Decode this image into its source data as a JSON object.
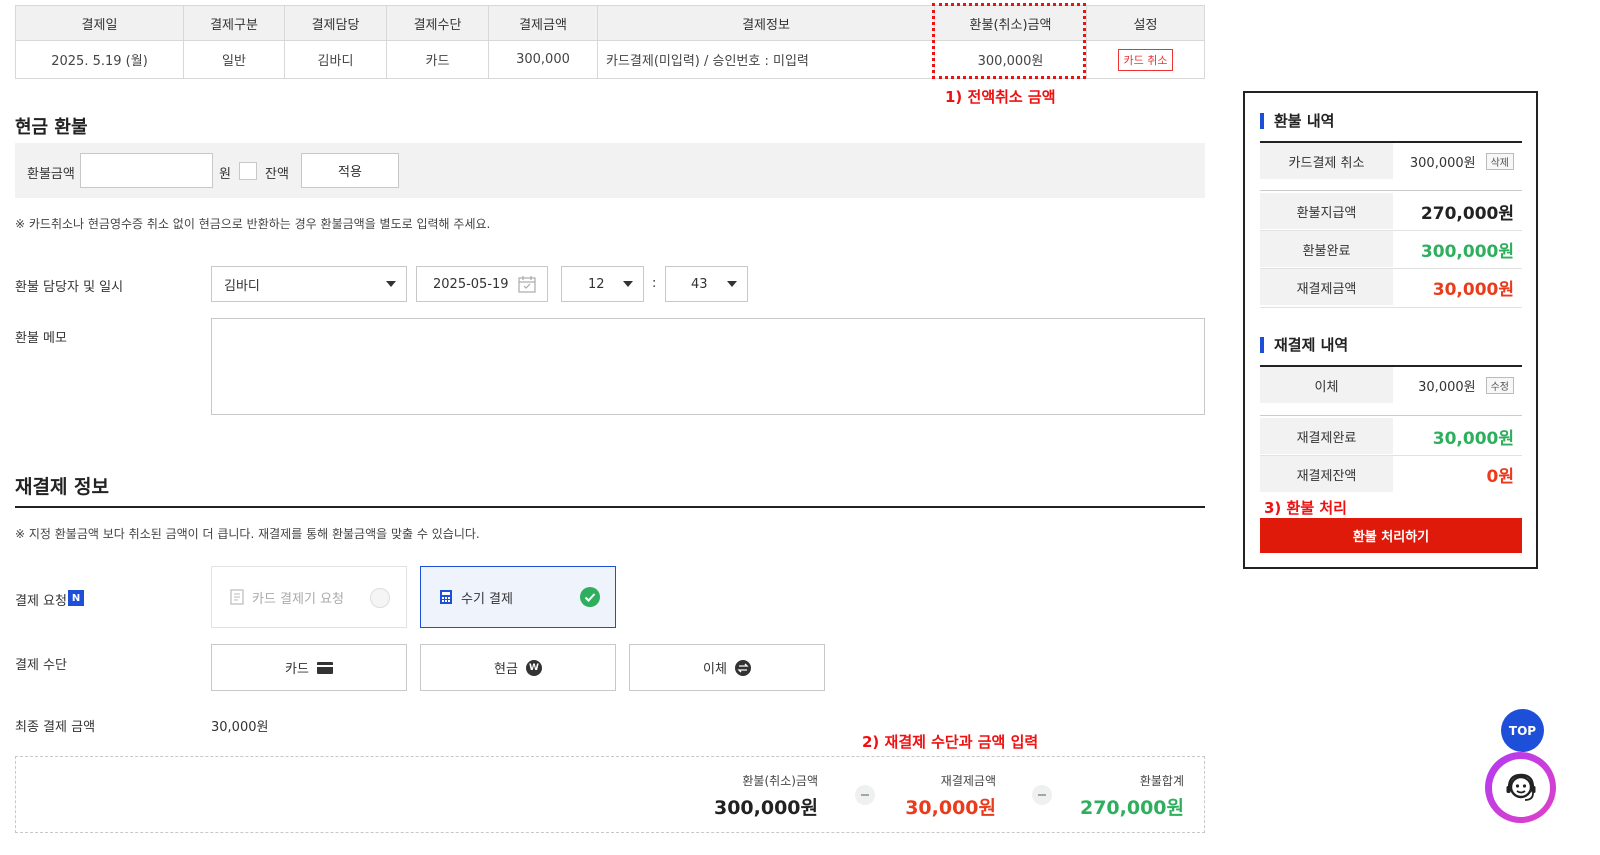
{
  "table": {
    "headers": [
      "결제일",
      "결제구분",
      "결제담당",
      "결제수단",
      "결제금액",
      "결제정보",
      "환불(취소)금액",
      "설정"
    ],
    "row": {
      "date": "2025. 5.19 (월)",
      "type": "일반",
      "manager": "김바디",
      "method": "카드",
      "amount": "300,000",
      "info": "카드결제(미입력) / 승인번호 : 미입력",
      "refund": "300,000원",
      "action": "카드 취소"
    }
  },
  "annotations": {
    "a1": "1) 전액취소 금액",
    "a2": "2) 재결제 수단과 금액 입력",
    "a3": "3) 환불 처리"
  },
  "cash": {
    "title": "현금 환불",
    "amount_label": "환불금액",
    "amount_value": "",
    "unit": "원",
    "balance_label": "잔액",
    "apply_label": "적용",
    "note": "※ 카드취소나 현금영수증 취소 없이 현금으로 반환하는 경우 환불금액을 별도로 입력해 주세요."
  },
  "refund_meta": {
    "manager_label": "환불 담당자 및 일시",
    "manager": "김바디",
    "date": "2025-05-19",
    "hour": "12",
    "colon": ":",
    "minute": "43",
    "memo_label": "환불 메모",
    "memo_value": ""
  },
  "repay": {
    "title": "재결제 정보",
    "note": "※ 지정 환불금액 보다 취소된 금액이 더 큽니다. 재결제를 통해 환불금액을 맞출 수 있습니다.",
    "request_label": "결제 요청",
    "new_badge": "N",
    "option_terminal": "카드 결제기 요청",
    "option_manual": "수기 결제",
    "method_label": "결제 수단",
    "methods": [
      "카드",
      "현금",
      "이체"
    ],
    "final_label": "최종 결제 금액",
    "final_value": "30,000원"
  },
  "summary": {
    "refund_label": "환불(취소)금액",
    "refund_value": "300,000원",
    "repay_label": "재결제금액",
    "repay_value": "30,000원",
    "total_label": "환불합계",
    "total_value": "270,000원"
  },
  "panel": {
    "refund_title": "환불 내역",
    "card_cancel_label": "카드결제 취소",
    "card_cancel_value": "300,000원",
    "delete_tag": "삭제",
    "pay_amount_label": "환불지급액",
    "pay_amount_value": "270,000원",
    "done_label": "환불완료",
    "done_value": "300,000원",
    "repay_amount_label": "재결제금액",
    "repay_amount_value": "30,000원",
    "repay_title": "재결제 내역",
    "transfer_label": "이체",
    "transfer_value": "30,000원",
    "edit_tag": "수정",
    "repay_done_label": "재결제완료",
    "repay_done_value": "30,000원",
    "repay_rest_label": "재결제잔액",
    "repay_rest_value": "0원",
    "process_button": "환불 처리하기"
  },
  "floating": {
    "top_label": "TOP"
  },
  "colors": {
    "green": "#2fae5e",
    "red": "#ea3b1c",
    "primary_button": "#e01a0a",
    "accent_blue": "#1e4fd8"
  }
}
